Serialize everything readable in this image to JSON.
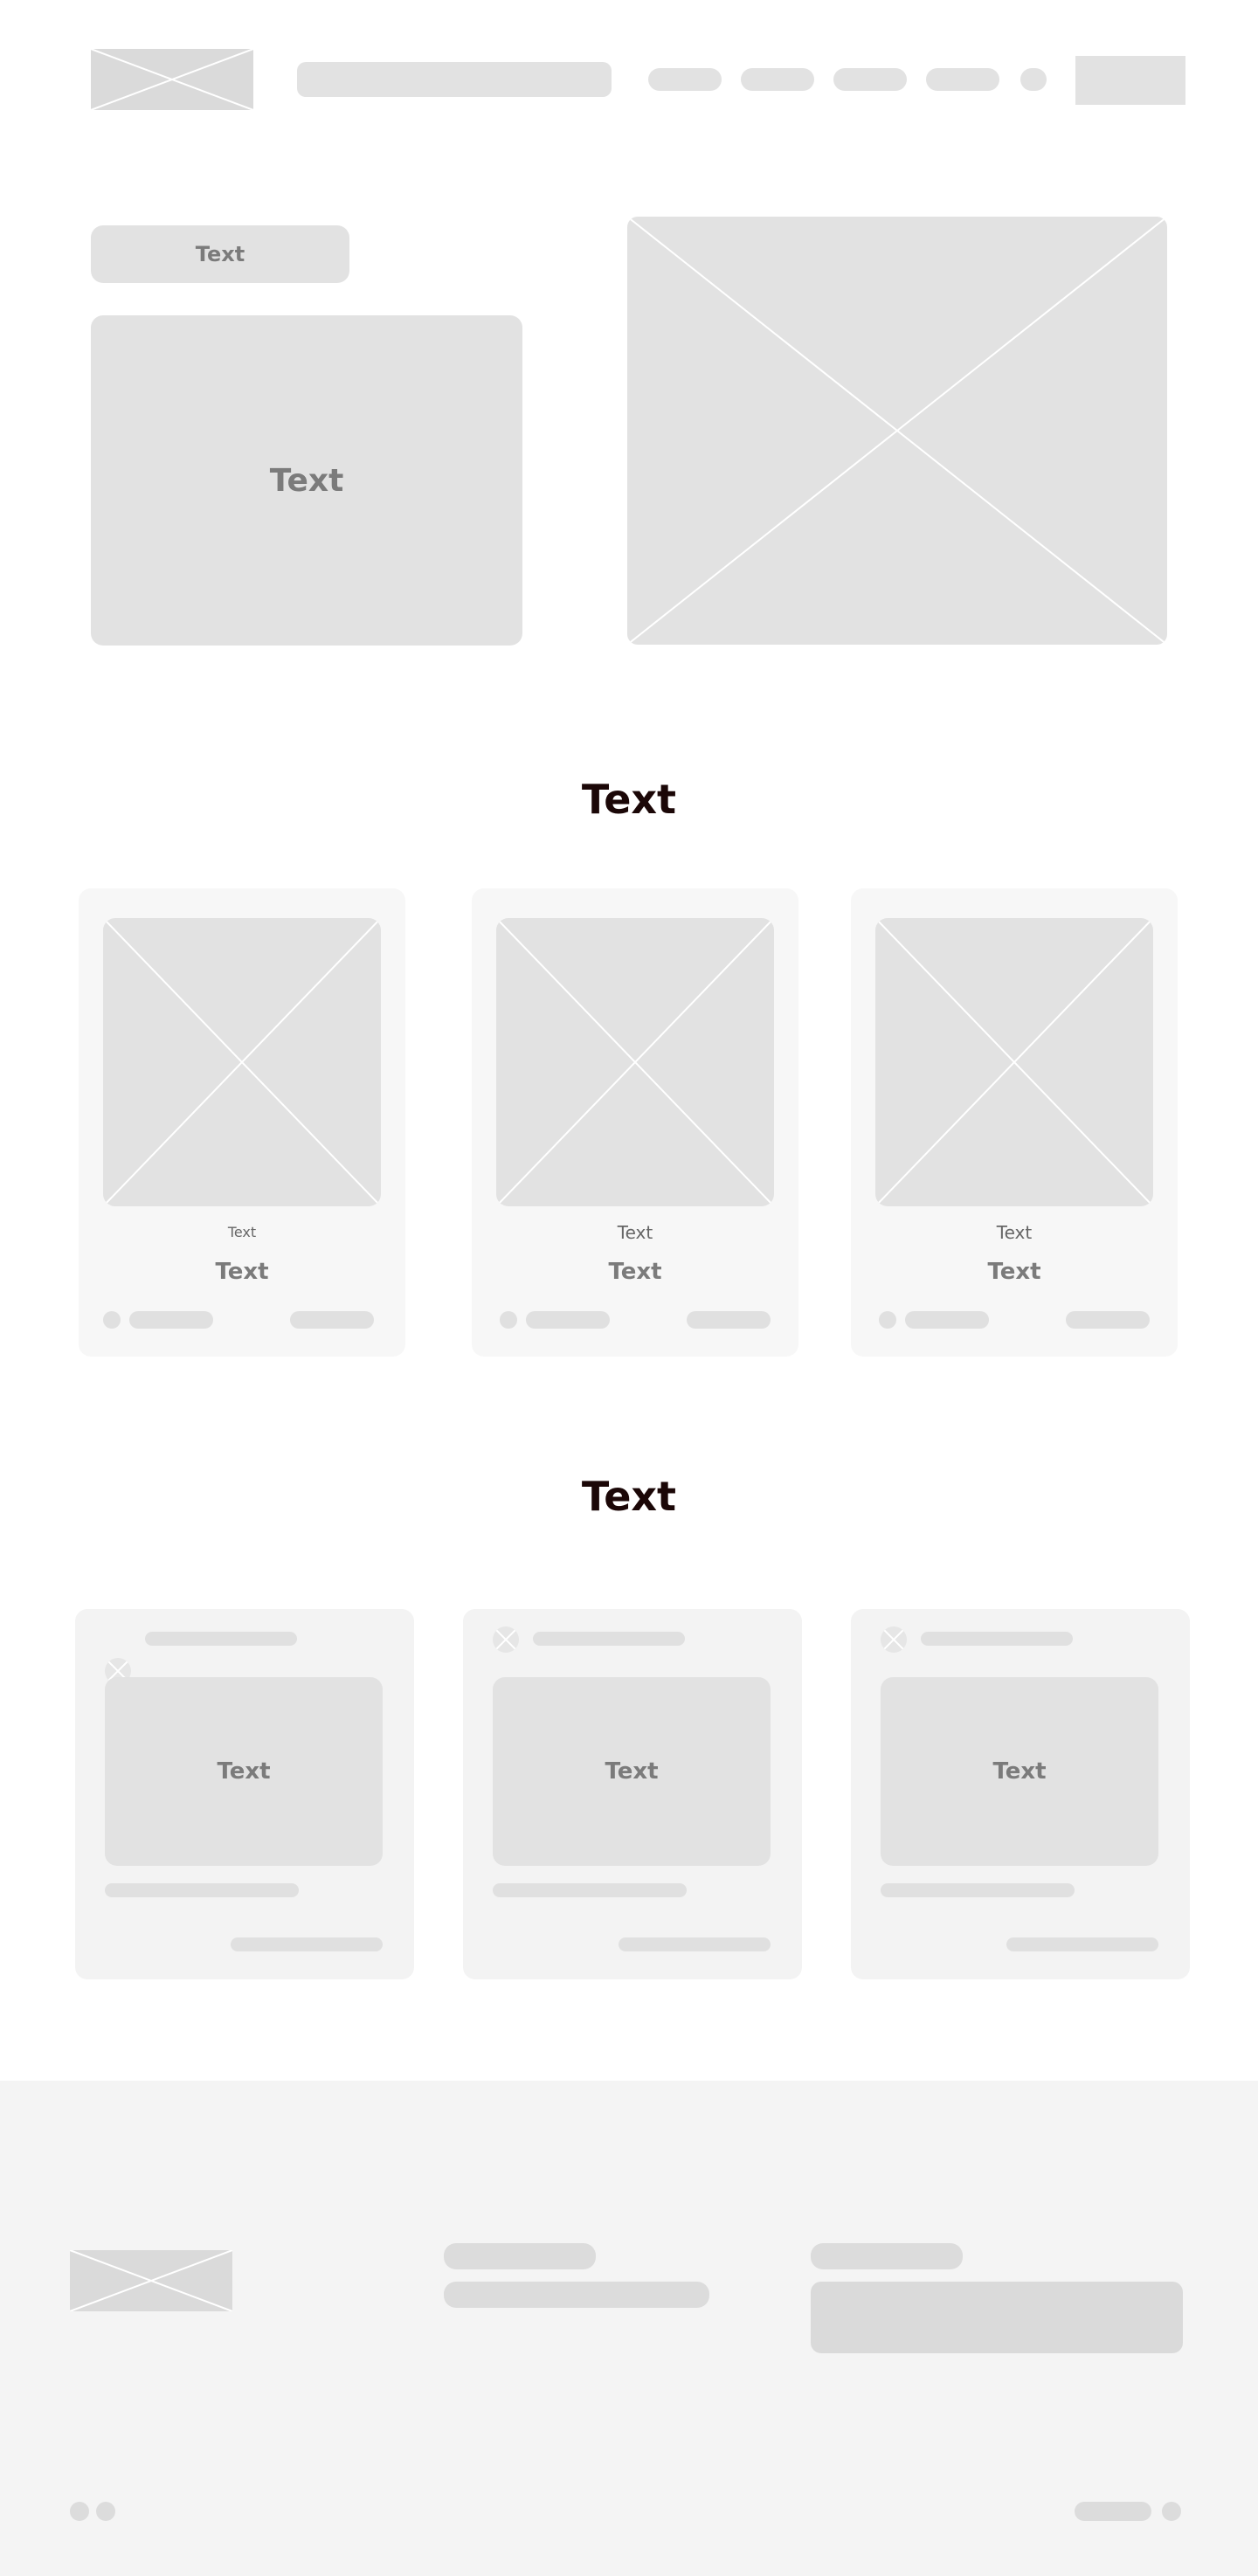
{
  "hero": {
    "badge_label": "Text",
    "headline": "Text"
  },
  "section_products": {
    "title": "Text",
    "cards": [
      {
        "kicker": "Text",
        "title": "Text"
      },
      {
        "kicker": "Text",
        "title": "Text"
      },
      {
        "kicker": "Text",
        "title": "Text"
      }
    ]
  },
  "section_posts": {
    "title": "Text",
    "cards": [
      {
        "media_label": "Text"
      },
      {
        "media_label": "Text"
      },
      {
        "media_label": "Text"
      }
    ]
  },
  "icons": {
    "logo": "image-placeholder-icon",
    "avatar": "image-placeholder-icon"
  }
}
